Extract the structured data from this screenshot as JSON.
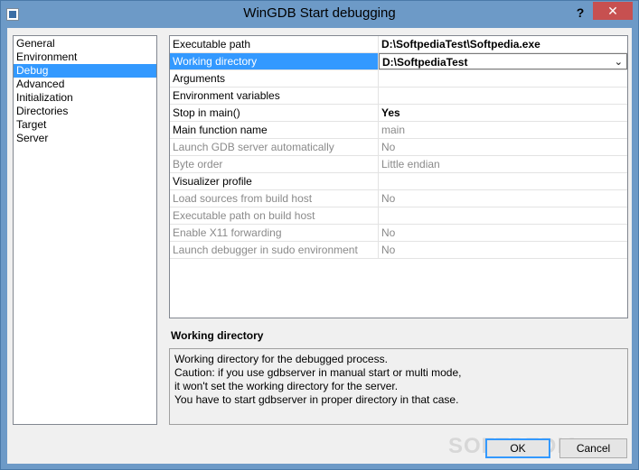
{
  "window": {
    "title": "WinGDB Start debugging",
    "help_glyph": "?",
    "close_glyph": "✕"
  },
  "nav": {
    "items": [
      {
        "label": "General"
      },
      {
        "label": "Environment"
      },
      {
        "label": "Debug"
      },
      {
        "label": "Advanced"
      },
      {
        "label": "Initialization"
      },
      {
        "label": "Directories"
      },
      {
        "label": "Target"
      },
      {
        "label": "Server"
      }
    ],
    "selected": "Debug"
  },
  "properties": {
    "rows": [
      {
        "name": "Executable path",
        "value": "D:\\SoftpediaTest\\Softpedia.exe"
      },
      {
        "name": "Working directory",
        "value": "D:\\SoftpediaTest"
      },
      {
        "name": "Arguments",
        "value": ""
      },
      {
        "name": "Environment variables",
        "value": ""
      },
      {
        "name": "Stop in main()",
        "value": "Yes"
      },
      {
        "name": "Main function name",
        "value": "main"
      },
      {
        "name": "Launch GDB server automatically",
        "value": "No"
      },
      {
        "name": "Byte order",
        "value": "Little endian"
      },
      {
        "name": "Visualizer profile",
        "value": ""
      },
      {
        "name": "Load sources from build host",
        "value": "No"
      },
      {
        "name": "Executable path on build host",
        "value": ""
      },
      {
        "name": "Enable X11 forwarding",
        "value": "No"
      },
      {
        "name": "Launch debugger in sudo environment",
        "value": "No"
      }
    ]
  },
  "description": {
    "title": "Working directory",
    "lines": [
      "Working directory for the debugged process.",
      "Caution: if you use gdbserver in manual start or multi mode,",
      "it won't set the working directory for the server.",
      "You have to start gdbserver in proper directory in that case."
    ]
  },
  "buttons": {
    "ok": "OK",
    "cancel": "Cancel"
  },
  "watermark": "SOFTPEDIA",
  "colors": {
    "title_bar": "#6d9ac7",
    "selection": "#3399ff",
    "close_button": "#c75050"
  }
}
